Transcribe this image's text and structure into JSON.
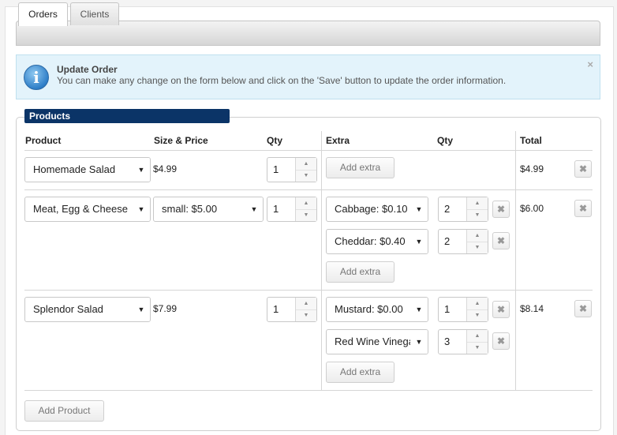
{
  "tabs": [
    {
      "label": "Orders",
      "active": true
    },
    {
      "label": "Clients",
      "active": false
    }
  ],
  "alert": {
    "icon": "info-icon",
    "title": "Update Order",
    "message": "You can make any change on the form below and click on the 'Save' button to update the order information.",
    "close": "×"
  },
  "panel": {
    "legend": "Products",
    "headers": {
      "product": "Product",
      "size_price": "Size & Price",
      "qty": "Qty",
      "extra": "Extra",
      "extra_qty": "Qty",
      "total": "Total"
    },
    "rows": [
      {
        "product": "Homemade Salad",
        "size_price": "$4.99",
        "qty": "1",
        "extras": [],
        "add_extra": "Add extra",
        "total": "$4.99"
      },
      {
        "product": "Meat, Egg & Cheese",
        "size_select": "small: $5.00",
        "qty": "1",
        "extras": [
          {
            "name": "Cabbage: $0.10",
            "qty": "2"
          },
          {
            "name": "Cheddar: $0.40",
            "qty": "2"
          }
        ],
        "add_extra": "Add extra",
        "total": "$6.00"
      },
      {
        "product": "Splendor Salad",
        "size_price": "$7.99",
        "qty": "1",
        "extras": [
          {
            "name": "Mustard: $0.00",
            "qty": "1"
          },
          {
            "name": "Red Wine Vinegar",
            "qty": "3"
          }
        ],
        "add_extra": "Add extra",
        "total": "$8.14"
      }
    ],
    "add_product": "Add Product"
  },
  "glyphs": {
    "dropdown": "▼",
    "spin_up": "▲",
    "spin_down": "▼",
    "remove": "✖"
  }
}
